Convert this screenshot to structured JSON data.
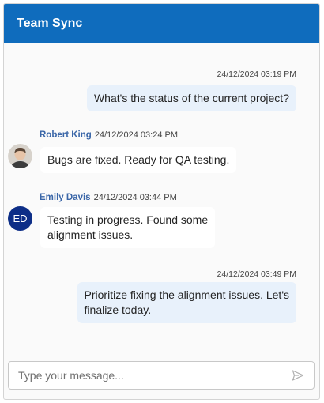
{
  "header": {
    "title": "Team Sync"
  },
  "messages": [
    {
      "type": "outgoing",
      "timestamp": "24/12/2024 03:19 PM",
      "lines": [
        "What's the status of the current project?"
      ]
    },
    {
      "type": "incoming",
      "sender": "Robert King",
      "timestamp": "24/12/2024 03:24 PM",
      "avatar": "photo",
      "lines": [
        "Bugs are fixed. Ready for QA testing."
      ]
    },
    {
      "type": "incoming",
      "sender": "Emily Davis",
      "timestamp": "24/12/2024 03:44 PM",
      "avatar_initials": "ED",
      "avatar_color": "#0d2e87",
      "lines": [
        "Testing in progress. Found some",
        "alignment issues."
      ]
    },
    {
      "type": "outgoing",
      "timestamp": "24/12/2024 03:49 PM",
      "lines": [
        "Prioritize fixing the alignment issues. Let's",
        "finalize today."
      ]
    }
  ],
  "composer": {
    "placeholder": "Type your message...",
    "send_icon": "send-icon"
  },
  "colors": {
    "header": "#0f6cbd",
    "outgoing_bubble": "#e8f1fb",
    "incoming_bubble": "#ffffff",
    "sender_name": "#3a66a8"
  }
}
